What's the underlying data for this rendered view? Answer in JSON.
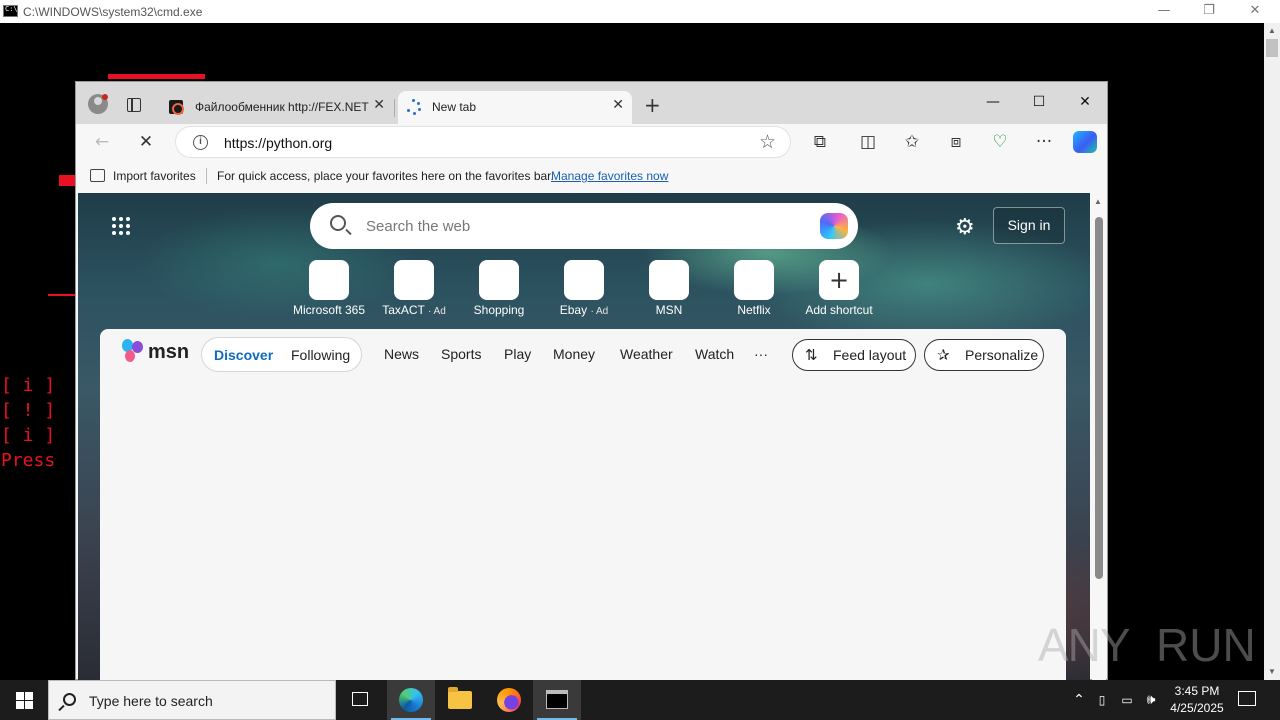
{
  "cmd": {
    "title": "C:\\WINDOWS\\system32\\cmd.exe",
    "minimize": "—",
    "restore": "❐",
    "close": "✕",
    "lines": [
      "[ i ]",
      "[ ! ]",
      "[ i ]",
      "Press"
    ]
  },
  "browser": {
    "tabs": [
      {
        "label": "Файлообменник http://FEX.NET",
        "close": "✕"
      },
      {
        "label": "New tab",
        "close": "✕"
      }
    ],
    "new_tab": "+",
    "window": {
      "minimize": "—",
      "maximize": "☐",
      "close": "✕"
    },
    "toolbar": {
      "back": "←",
      "stop": "✕",
      "url": "https://python.org",
      "info": "i",
      "star": "☆",
      "extensions": "⧉",
      "split": "◫",
      "favorites": "✩",
      "collections": "⧈",
      "health": "♡",
      "more": "···"
    },
    "favorites_bar": {
      "import": "Import favorites",
      "hint": "For quick access, place your favorites here on the favorites bar.",
      "manage": "Manage favorites now"
    }
  },
  "newtab": {
    "search_placeholder": "Search the web",
    "settings": "⚙",
    "sign_in": "Sign in",
    "shortcuts": [
      {
        "label": "Microsoft 365",
        "ad": ""
      },
      {
        "label": "TaxACT",
        "ad": "· Ad"
      },
      {
        "label": "Shopping",
        "ad": ""
      },
      {
        "label": "Ebay",
        "ad": "· Ad"
      },
      {
        "label": "MSN",
        "ad": ""
      },
      {
        "label": "Netflix",
        "ad": ""
      },
      {
        "label": "Add shortcut",
        "ad": "",
        "icon": "+"
      }
    ],
    "feed": {
      "logo": "msn",
      "tabs": [
        "Discover",
        "Following"
      ],
      "nav": [
        "News",
        "Sports",
        "Play",
        "Money",
        "Weather",
        "Watch",
        "···"
      ],
      "feed_layout": "Feed layout",
      "personalize": "Personalize",
      "feed_layout_icon": "⇅",
      "personalize_icon": "✰"
    }
  },
  "watermark": {
    "left": "ANY",
    "right": "RUN"
  },
  "taskbar": {
    "search_placeholder": "Type here to search",
    "time": "3:45 PM",
    "date": "4/25/2025",
    "tray_chevron": "⌃",
    "volume": "🕪"
  },
  "colors": {
    "accent": "#0f6cbd",
    "cmd_red": "#e81123",
    "taskbar": "#1c1c1c"
  }
}
